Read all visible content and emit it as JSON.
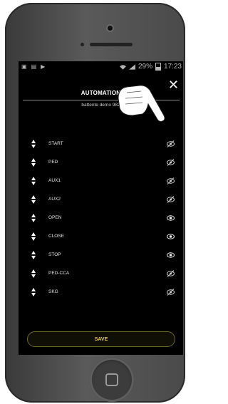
{
  "status_bar": {
    "time": "17:23",
    "battery": "29%"
  },
  "header": {
    "title": "AUTOMATION",
    "subtitle": "battente demo 982",
    "close_label": "✕"
  },
  "items": [
    {
      "label": "START",
      "visible": false
    },
    {
      "label": "PED",
      "visible": false
    },
    {
      "label": "AUX1",
      "visible": false
    },
    {
      "label": "AUX2",
      "visible": false
    },
    {
      "label": "OPEN",
      "visible": true
    },
    {
      "label": "CLOSE",
      "visible": true
    },
    {
      "label": "STOP",
      "visible": true
    },
    {
      "label": "PED-CCA",
      "visible": false
    },
    {
      "label": "SKG",
      "visible": false
    }
  ],
  "footer": {
    "save_label": "SAVE"
  }
}
